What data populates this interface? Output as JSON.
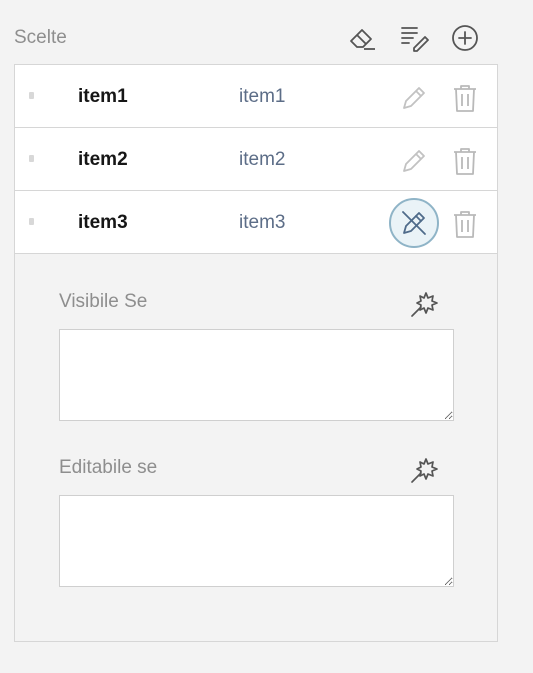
{
  "header": {
    "title": "Scelte",
    "actions": [
      {
        "name": "clear-button",
        "icon": "eraser-icon"
      },
      {
        "name": "edit-list-button",
        "icon": "list-edit-icon"
      },
      {
        "name": "add-button",
        "icon": "plus-circle-icon"
      }
    ]
  },
  "choices": [
    {
      "value": "item1",
      "text": "item1",
      "editing": false
    },
    {
      "value": "item2",
      "text": "item2",
      "editing": false
    },
    {
      "value": "item3",
      "text": "item3",
      "editing": true
    }
  ],
  "editor": {
    "visible_if_label": "Visibile Se",
    "visible_if_value": "",
    "enable_if_label": "Editabile se",
    "enable_if_value": ""
  },
  "colors": {
    "accent": "#5c6d87",
    "active_ring": "#8fb4c7",
    "icon_gray": "#b9b9b9"
  }
}
